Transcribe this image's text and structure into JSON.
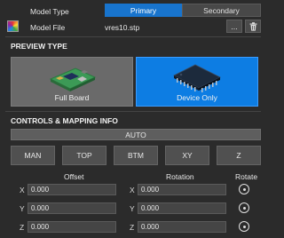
{
  "header": {
    "model_type_label": "Model Type",
    "model_type_options": [
      "Primary",
      "Secondary"
    ],
    "model_type_selected": "Primary",
    "model_file_label": "Model File",
    "model_file_value": "vres10.stp",
    "browse_label": "..."
  },
  "preview": {
    "title": "PREVIEW TYPE",
    "full_board_label": "Full Board",
    "device_only_label": "Device Only",
    "selected": "Device Only"
  },
  "controls": {
    "title": "CONTROLS & MAPPING INFO",
    "auto_label": "AUTO",
    "views": [
      "MAN",
      "TOP",
      "BTM",
      "XY",
      "Z"
    ],
    "offset_label": "Offset",
    "rotation_label": "Rotation",
    "rotate_label": "Rotate",
    "axes": [
      "X",
      "Y",
      "Z"
    ],
    "offset_values": [
      "0.000",
      "0.000",
      "0.000"
    ],
    "rotation_values": [
      "0.000",
      "0.000",
      "0.000"
    ]
  },
  "colors": {
    "accent": "#1874cd",
    "background": "#2b2b2b"
  }
}
